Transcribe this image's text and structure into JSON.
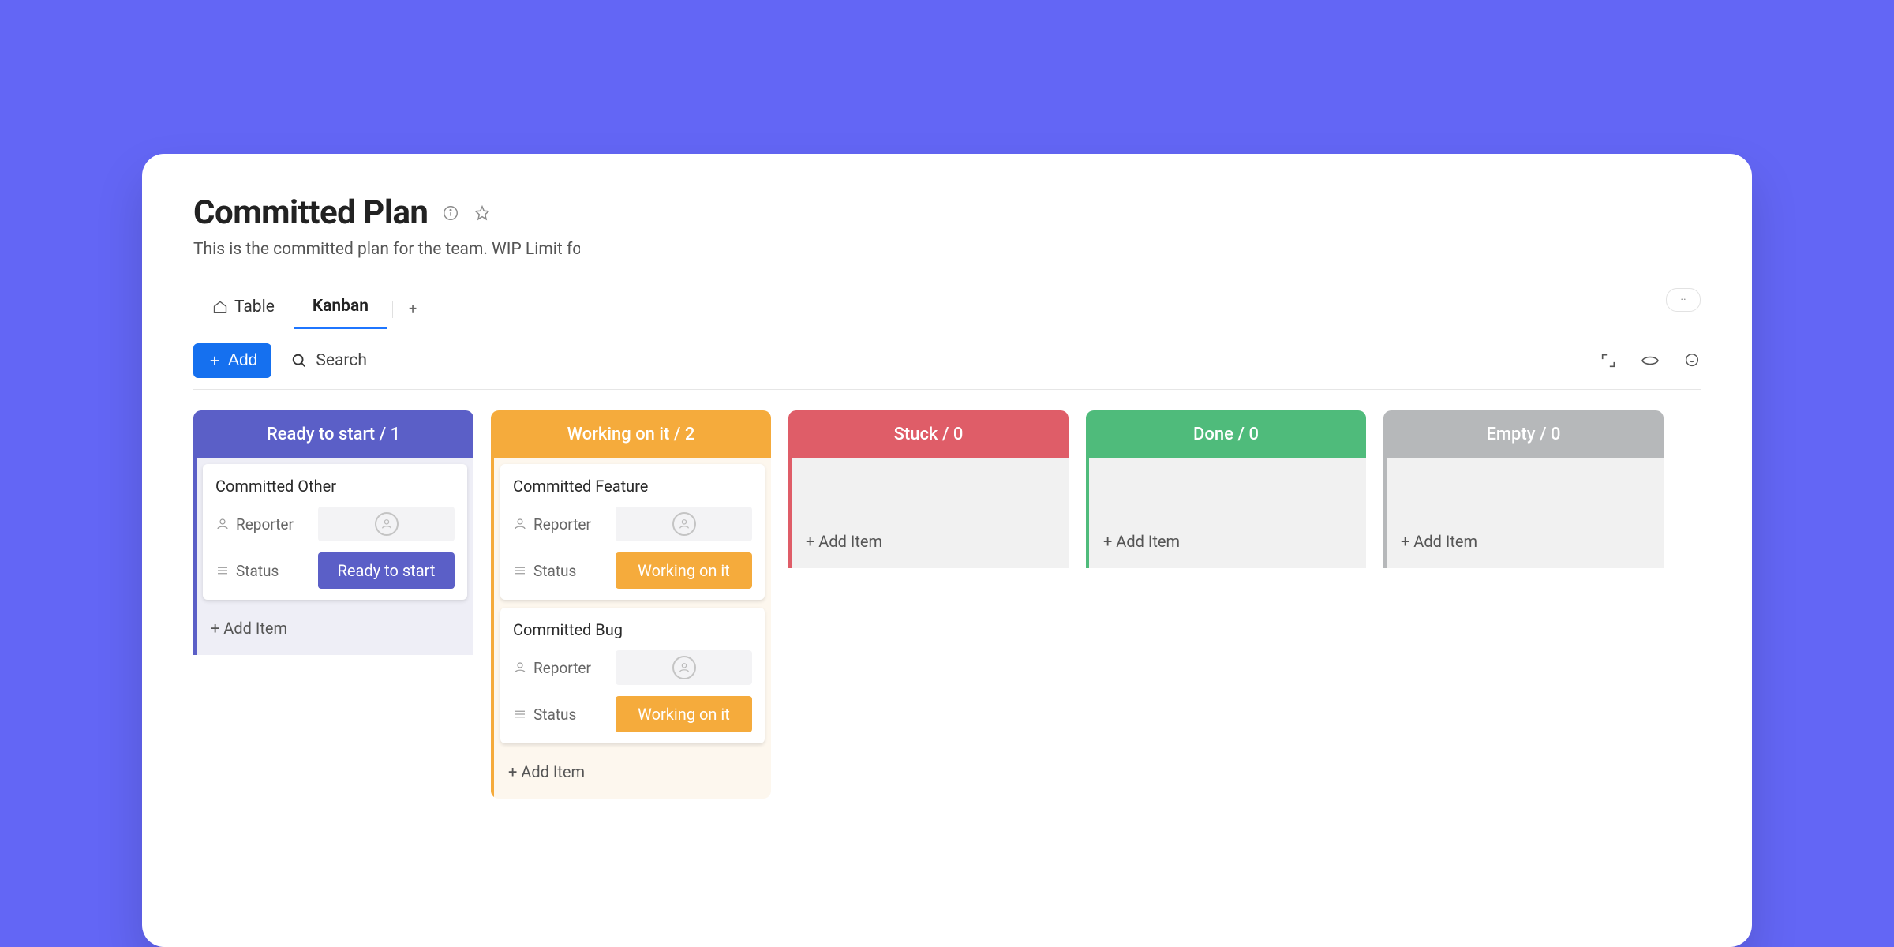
{
  "board": {
    "title": "Committed Plan",
    "subtitle": "This is the committed plan for the team. WIP Limit for the"
  },
  "tabs": {
    "table": "Table",
    "kanban": "Kanban"
  },
  "actions": {
    "add": "Add",
    "search": "Search"
  },
  "labels": {
    "reporter": "Reporter",
    "status": "Status",
    "add_item": "+ Add Item"
  },
  "columns": {
    "ready": {
      "title": "Ready to start / 1"
    },
    "working": {
      "title": "Working on it / 2"
    },
    "stuck": {
      "title": "Stuck / 0"
    },
    "done": {
      "title": "Done / 0"
    },
    "empty": {
      "title": "Empty / 0"
    }
  },
  "cards": {
    "c1": {
      "title": "Committed Other",
      "status": "Ready to start"
    },
    "c2": {
      "title": "Committed Feature",
      "status": "Working on it"
    },
    "c3": {
      "title": "Committed Bug",
      "status": "Working on it"
    }
  }
}
